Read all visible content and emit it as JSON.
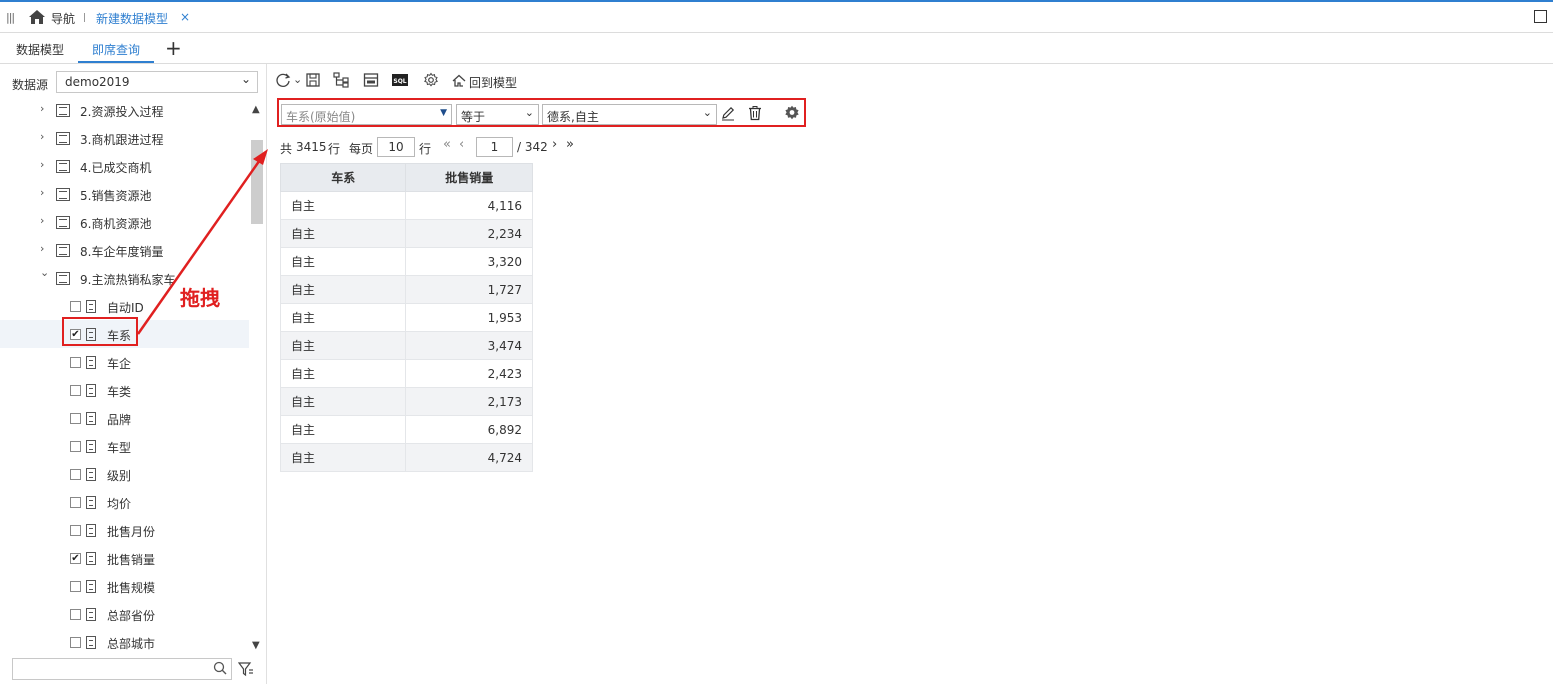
{
  "topbar": {
    "menu_icon": "menu-icon",
    "home_icon": "home-icon",
    "nav_label": "导航",
    "tab_title": "新建数据模型",
    "close": "×",
    "maximize_icon": "maximize-icon"
  },
  "tabs": {
    "model": "数据模型",
    "query": "即席查询",
    "add": "+"
  },
  "sidebar": {
    "datasource_label": "数据源",
    "datasource_value": "demo2019",
    "tables": [
      {
        "label": "2.资源投入过程"
      },
      {
        "label": "3.商机跟进过程"
      },
      {
        "label": "4.已成交商机"
      },
      {
        "label": "5.销售资源池"
      },
      {
        "label": "6.商机资源池"
      },
      {
        "label": "8.车企年度销量"
      },
      {
        "label": "9.主流热销私家车"
      }
    ],
    "fields": [
      {
        "label": "自动ID",
        "checked": false
      },
      {
        "label": "车系",
        "checked": true
      },
      {
        "label": "车企",
        "checked": false
      },
      {
        "label": "车类",
        "checked": false
      },
      {
        "label": "品牌",
        "checked": false
      },
      {
        "label": "车型",
        "checked": false
      },
      {
        "label": "级别",
        "checked": false
      },
      {
        "label": "均价",
        "checked": false
      },
      {
        "label": "批售月份",
        "checked": false
      },
      {
        "label": "批售销量",
        "checked": true
      },
      {
        "label": "批售规模",
        "checked": false
      },
      {
        "label": "总部省份",
        "checked": false
      },
      {
        "label": "总部城市",
        "checked": false
      }
    ],
    "search_placeholder": ""
  },
  "toolbar": {
    "back_label": "回到模型",
    "sql_label": "SQL"
  },
  "filter": {
    "field": "车系(原始值)",
    "operator": "等于",
    "value": "德系,自主"
  },
  "pager": {
    "total_prefix": "共",
    "total": "3415",
    "rows_unit": "行",
    "per_page_label": "每页",
    "per_page": "10",
    "per_page_unit": "行",
    "page": "1",
    "page_total": "/ 342"
  },
  "grid": {
    "headers": [
      "车系",
      "批售销量"
    ],
    "rows": [
      [
        "自主",
        "4,116"
      ],
      [
        "自主",
        "2,234"
      ],
      [
        "自主",
        "3,320"
      ],
      [
        "自主",
        "1,727"
      ],
      [
        "自主",
        "1,953"
      ],
      [
        "自主",
        "3,474"
      ],
      [
        "自主",
        "2,423"
      ],
      [
        "自主",
        "2,173"
      ],
      [
        "自主",
        "6,892"
      ],
      [
        "自主",
        "4,724"
      ]
    ]
  },
  "annotation": {
    "text": "拖拽",
    "color": "#e02020"
  },
  "colors": {
    "accent": "#2f7fd0",
    "highlight": "#e02020"
  }
}
